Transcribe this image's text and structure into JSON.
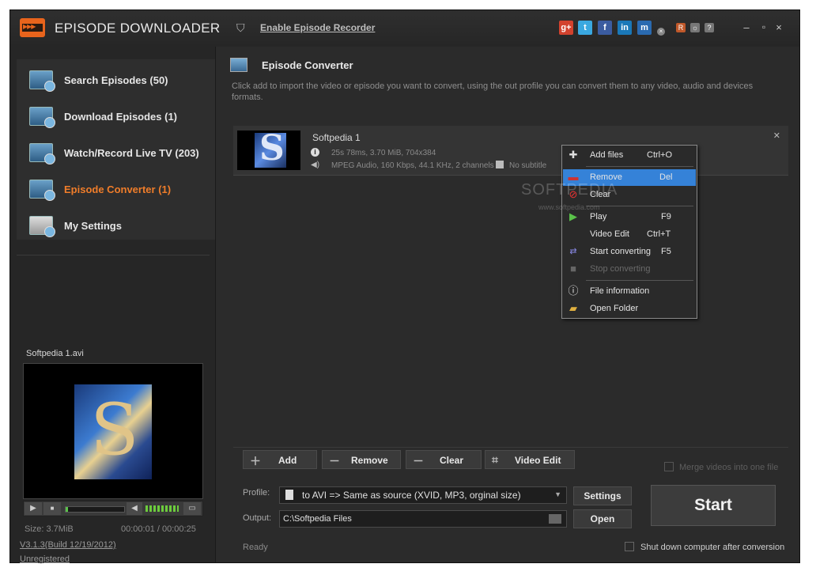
{
  "app": {
    "title": "EPISODE DOWNLOADER",
    "recorder_link": "Enable Episode Recorder"
  },
  "social": [
    "g+",
    "t",
    "f",
    "in",
    "m"
  ],
  "header_small": [
    "R",
    "☼",
    "?"
  ],
  "window_controls": {
    "minimize": "–",
    "maximize": "▫",
    "close": "×"
  },
  "sidebar": {
    "items": [
      {
        "label": "Search Episodes  (50)"
      },
      {
        "label": "Download Episodes  (1)"
      },
      {
        "label": "Watch/Record Live TV  (203)"
      },
      {
        "label": "Episode Converter  (1)"
      },
      {
        "label": "My Settings"
      }
    ],
    "preview_name": "Softpedia 1.avi",
    "size": "Size: 3.7MiB",
    "time": "00:00:01 / 00:00:25",
    "version": "V3.1.3(Build 12/19/2012)",
    "registration": "Unregistered"
  },
  "player": {
    "play": "▶",
    "stop": "■",
    "vol": "◀",
    "full": "▭"
  },
  "converter": {
    "title": "Episode Converter",
    "description": "Click add to import the video or episode you want to convert, using the out profile you can convert them to any video, audio and devices formats.",
    "files": [
      {
        "name": "Softpedia 1",
        "video_info": "25s 78ms, 3.70 MiB, 704x384",
        "audio_info": "MPEG Audio, 160 Kbps, 44.1 KHz, 2 channels",
        "subtitle": "No subtitle"
      }
    ]
  },
  "context_menu": [
    {
      "label": "Add files",
      "key": "Ctrl+O"
    },
    {
      "label": "Remove",
      "key": "Del"
    },
    {
      "label": "Clear",
      "key": ""
    },
    {
      "label": "Play",
      "key": "F9"
    },
    {
      "label": "Video Edit",
      "key": "Ctrl+T"
    },
    {
      "label": "Start converting",
      "key": "F5"
    },
    {
      "label": "Stop converting",
      "key": ""
    },
    {
      "label": "File information",
      "key": ""
    },
    {
      "label": "Open Folder",
      "key": ""
    }
  ],
  "watermark": {
    "main": "SOFTPEDIA",
    "sub": "www.softpedia.com"
  },
  "toolbar": {
    "add": "Add",
    "remove": "Remove",
    "clear": "Clear",
    "video_edit": "Video Edit",
    "merge": "Merge videos into one file"
  },
  "output": {
    "profile_label": "Profile:",
    "profile_value": "to AVI => Same as source (XVID, MP3, orginal size)",
    "output_label": "Output:",
    "output_value": "C:\\Softpedia Files",
    "settings": "Settings",
    "open": "Open",
    "start": "Start"
  },
  "status": {
    "text": "Ready",
    "shutdown": "Shut down computer after conversion"
  },
  "colors": {
    "accent": "#f07d2a",
    "selection": "#3582d8"
  }
}
